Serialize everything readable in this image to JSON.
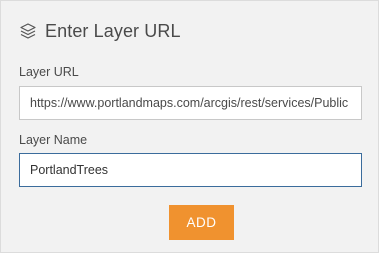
{
  "header": {
    "icon": "layers-icon",
    "title": "Enter Layer URL"
  },
  "form": {
    "url_label": "Layer URL",
    "url_value": "https://www.portlandmaps.com/arcgis/rest/services/Public",
    "name_label": "Layer Name",
    "name_value": "PortlandTrees",
    "add_label": "ADD"
  },
  "colors": {
    "accent": "#f0922f",
    "focus_border": "#3b6c9c",
    "panel_bg": "#f2f2f2"
  }
}
